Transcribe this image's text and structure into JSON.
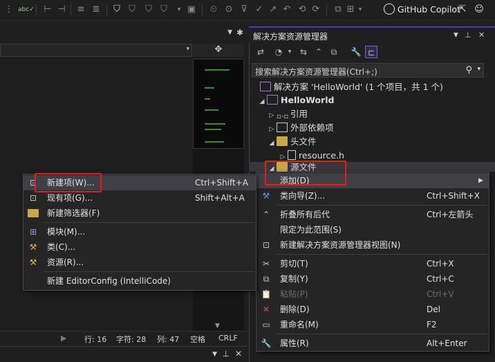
{
  "toolbar": {
    "icons": [
      "spellcheck-icon",
      "bookmark-icon",
      "comment-icon",
      "uncomment-icon",
      "bookmark-toggle-icon",
      "bookmark-prev-icon",
      "bookmark-next-icon",
      "bookmark-clear-icon",
      "breakpoint-icon",
      "git-icon",
      "undo-icon",
      "redo-icon",
      "history-icon",
      "window-icon"
    ],
    "copilot_label": "GitHub Copilot"
  },
  "editor": {
    "split_icon": "✥",
    "status": {
      "line": "行: 16",
      "col_char": "字符: 28",
      "col": "列: 47",
      "spaces": "空格",
      "eol": "CRLF"
    }
  },
  "solution_explorer": {
    "title": "解决方案资源管理器",
    "search_placeholder": "搜索解决方案资源管理器(Ctrl+;)",
    "tree": [
      {
        "label": "解决方案 'HelloWorld' (1 个项目，共 1 个)"
      },
      {
        "label": "HelloWorld"
      },
      {
        "label": "引用"
      },
      {
        "label": "外部依赖项"
      },
      {
        "label": "头文件"
      },
      {
        "label": "resource.h"
      },
      {
        "label": "源文件"
      }
    ]
  },
  "menu_main": {
    "items": [
      {
        "label": "添加(D)"
      },
      {
        "label": "类向导(Z)...",
        "shortcut": "Ctrl+Shift+X"
      },
      {
        "label": "折叠所有后代",
        "shortcut": "Ctrl+左箭头"
      },
      {
        "label": "限定为此范围(S)"
      },
      {
        "label": "新建解决方案资源管理器视图(N)"
      },
      {
        "label": "剪切(T)",
        "shortcut": "Ctrl+X"
      },
      {
        "label": "复制(Y)",
        "shortcut": "Ctrl+C"
      },
      {
        "label": "粘贴(P)",
        "shortcut": "Ctrl+V"
      },
      {
        "label": "删除(D)",
        "shortcut": "Del"
      },
      {
        "label": "重命名(M)",
        "shortcut": "F2"
      },
      {
        "label": "属性(R)",
        "shortcut": "Alt+Enter"
      }
    ]
  },
  "menu_sub": {
    "items": [
      {
        "label": "新建项(W)...",
        "shortcut": "Ctrl+Shift+A"
      },
      {
        "label": "现有项(G)...",
        "shortcut": "Shift+Alt+A"
      },
      {
        "label": "新建筛选器(F)"
      },
      {
        "label": "模块(M)..."
      },
      {
        "label": "类(C)..."
      },
      {
        "label": "资源(R)..."
      },
      {
        "label": "新建 EditorConfig (IntelliCode)"
      }
    ]
  },
  "colors": {
    "accent": "#3a3ad0",
    "highlight_box": "#e02020",
    "delete_icon": "#e05050"
  }
}
